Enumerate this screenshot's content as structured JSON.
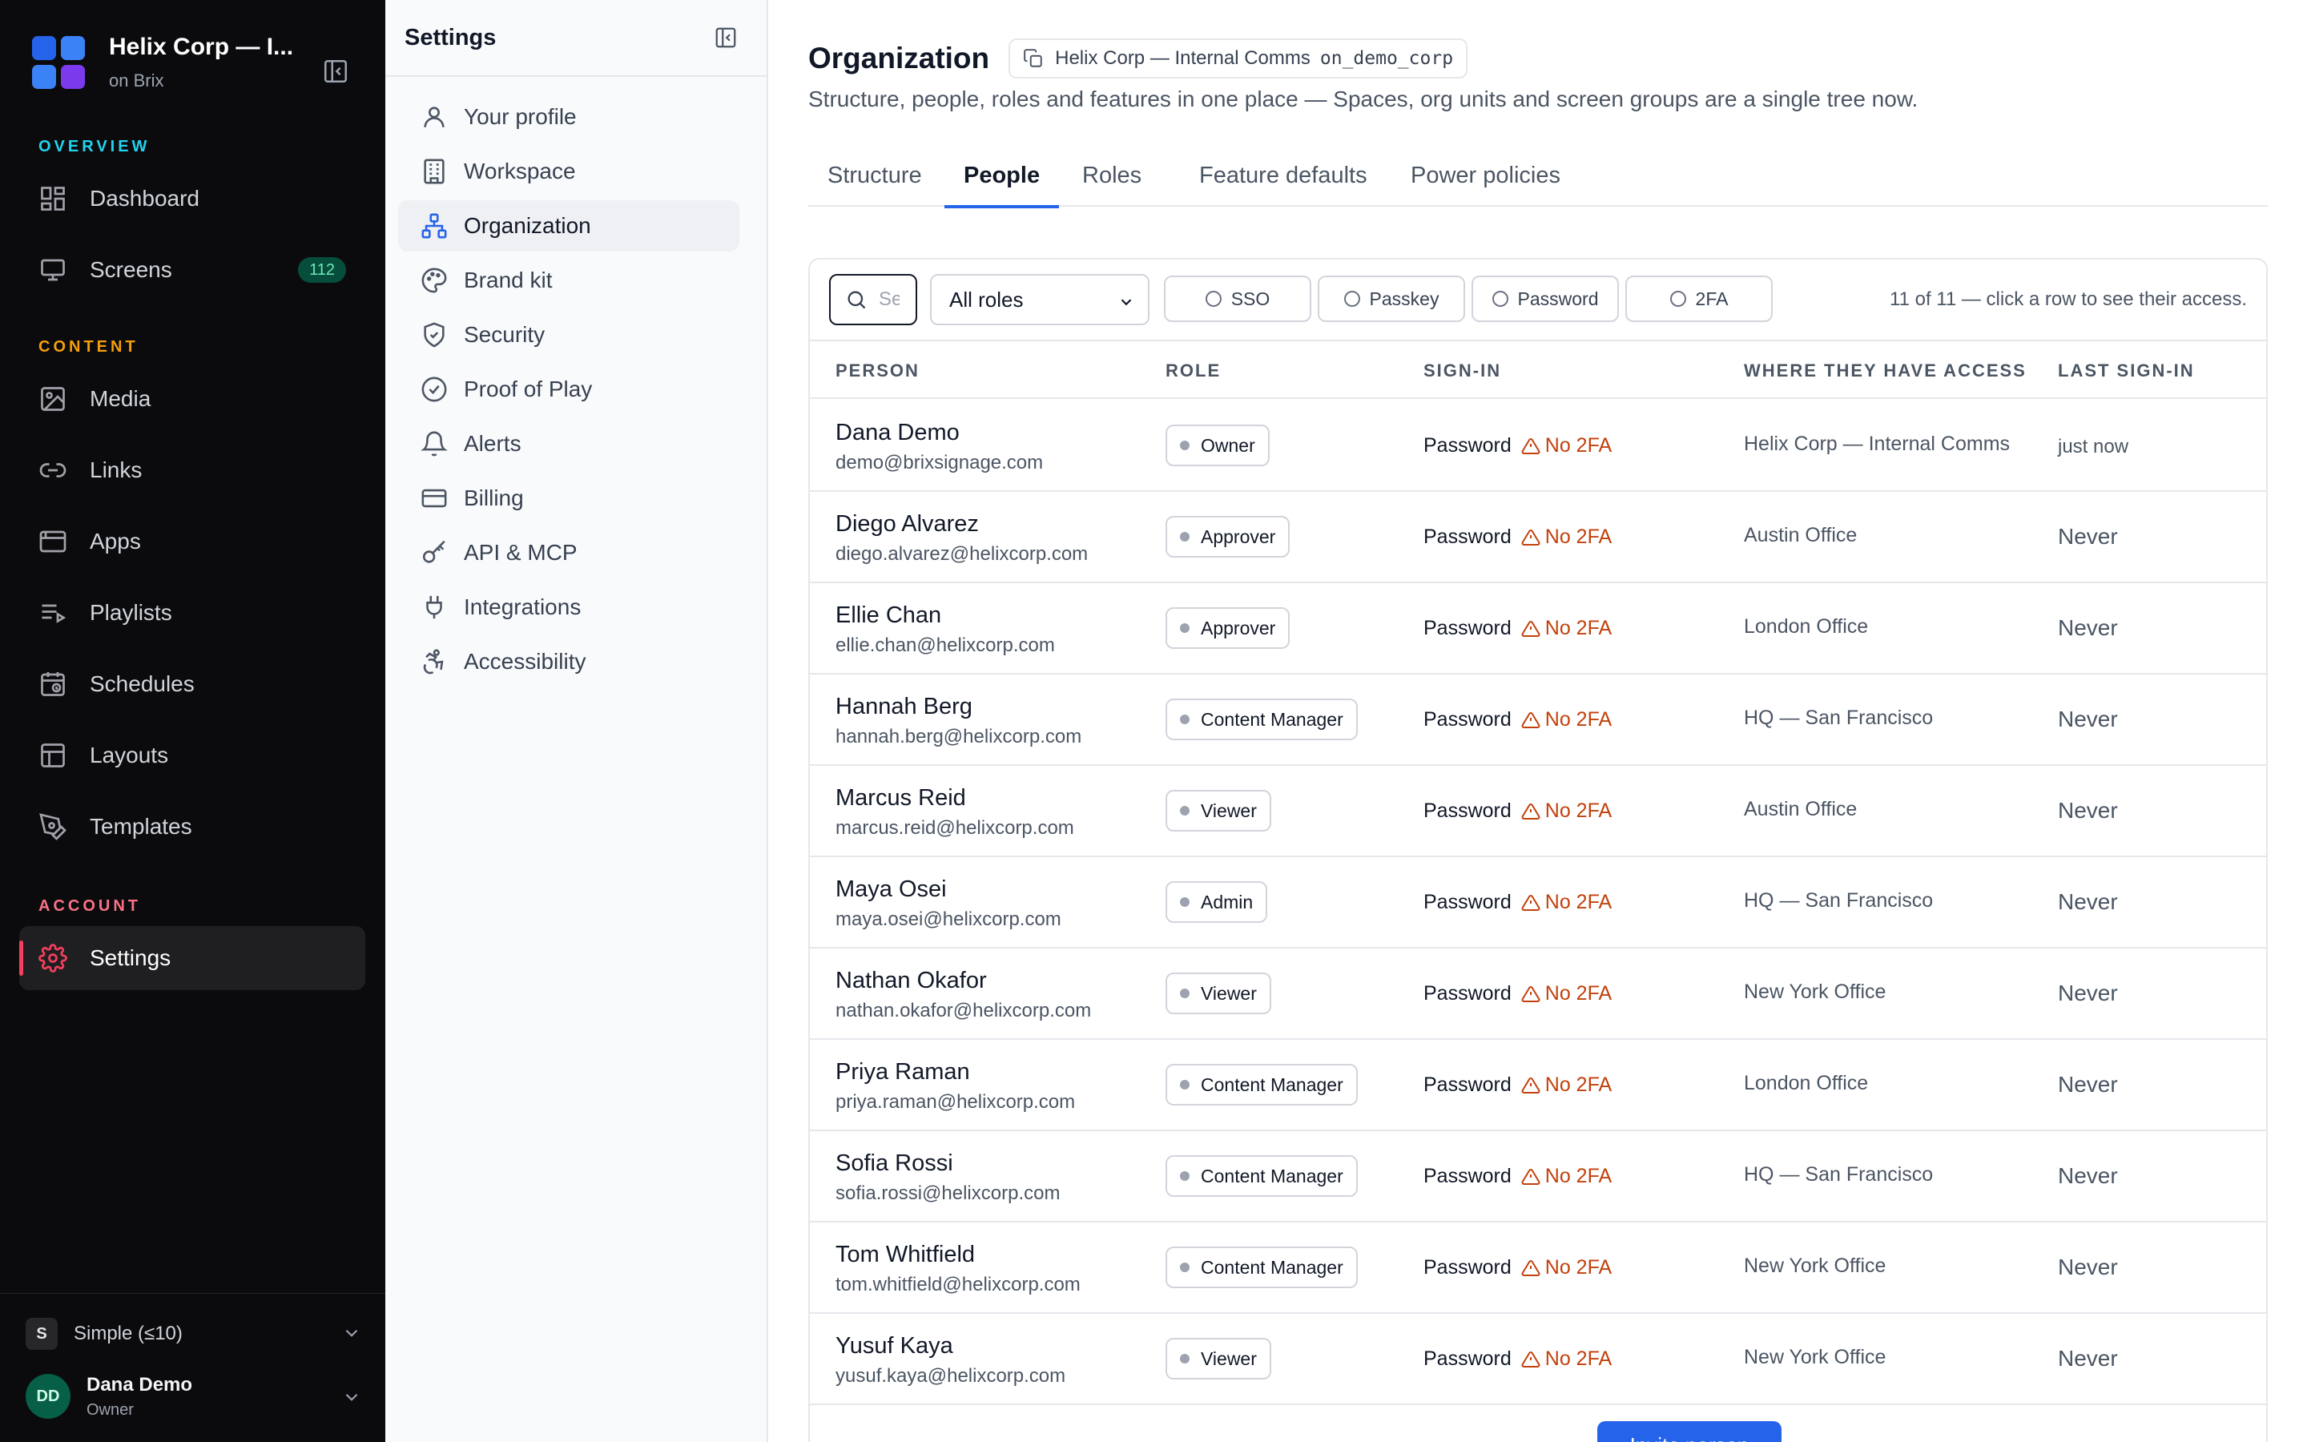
{
  "app": {
    "brand_title": "Helix Corp — I...",
    "brand_sub": "on Brix",
    "sections": {
      "overview": "OVERVIEW",
      "content": "CONTENT",
      "account": "ACCOUNT"
    },
    "nav": {
      "dashboard": "Dashboard",
      "screens": "Screens",
      "screens_count": "112",
      "media": "Media",
      "links": "Links",
      "apps": "Apps",
      "playlists": "Playlists",
      "schedules": "Schedules",
      "layouts": "Layouts",
      "templates": "Templates",
      "settings": "Settings"
    },
    "mode": {
      "chip": "S",
      "label": "Simple (≤10)"
    },
    "user": {
      "initials": "DD",
      "name": "Dana Demo",
      "role": "Owner"
    },
    "colors": {
      "accent": "#2563eb",
      "active_nav": "#f43f5e",
      "overview": "#22d3ee",
      "content": "#f59e0b",
      "account": "#fb7185",
      "warning": "#c2410c"
    }
  },
  "settings_nav": {
    "title": "Settings",
    "items": [
      {
        "label": "Your profile",
        "icon": "user-icon"
      },
      {
        "label": "Workspace",
        "icon": "building-icon"
      },
      {
        "label": "Organization",
        "icon": "org-chart-icon",
        "active": true
      },
      {
        "label": "Brand kit",
        "icon": "palette-icon"
      },
      {
        "label": "Security",
        "icon": "shield-icon"
      },
      {
        "label": "Proof of Play",
        "icon": "check-circle-icon"
      },
      {
        "label": "Alerts",
        "icon": "bell-icon"
      },
      {
        "label": "Billing",
        "icon": "credit-card-icon"
      },
      {
        "label": "API & MCP",
        "icon": "key-icon"
      },
      {
        "label": "Integrations",
        "icon": "plug-icon"
      },
      {
        "label": "Accessibility",
        "icon": "accessibility-icon"
      }
    ]
  },
  "page": {
    "title": "Organization",
    "org_name": "Helix Corp — Internal Comms",
    "org_code": "on_demo_corp",
    "subtitle": "Structure, people, roles and features in one place — Spaces, org units and screen groups are a single tree now.",
    "tabs": [
      "Structure",
      "People",
      "Roles",
      "Feature defaults",
      "Power policies"
    ],
    "active_tab": "People"
  },
  "people": {
    "search_placeholder": "Search",
    "role_filter": "All roles",
    "filters": [
      "SSO",
      "Passkey",
      "Password",
      "2FA"
    ],
    "count_text": "11 of 11 — click a row to see their access.",
    "columns": [
      "PERSON",
      "ROLE",
      "SIGN-IN",
      "WHERE THEY HAVE ACCESS",
      "LAST SIGN-IN"
    ],
    "rows": [
      {
        "name": "Dana Demo",
        "email": "demo@brixsignage.com",
        "role": "Owner",
        "signin": "Password",
        "warning": "No 2FA",
        "access": "Helix Corp — Internal Comms",
        "last": "just now"
      },
      {
        "name": "Diego Alvarez",
        "email": "diego.alvarez@helixcorp.com",
        "role": "Approver",
        "signin": "Password",
        "warning": "No 2FA",
        "access": "Austin Office",
        "last": "Never"
      },
      {
        "name": "Ellie Chan",
        "email": "ellie.chan@helixcorp.com",
        "role": "Approver",
        "signin": "Password",
        "warning": "No 2FA",
        "access": "London Office",
        "last": "Never"
      },
      {
        "name": "Hannah Berg",
        "email": "hannah.berg@helixcorp.com",
        "role": "Content Manager",
        "signin": "Password",
        "warning": "No 2FA",
        "access": "HQ — San Francisco",
        "last": "Never"
      },
      {
        "name": "Marcus Reid",
        "email": "marcus.reid@helixcorp.com",
        "role": "Viewer",
        "signin": "Password",
        "warning": "No 2FA",
        "access": "Austin Office",
        "last": "Never"
      },
      {
        "name": "Maya Osei",
        "email": "maya.osei@helixcorp.com",
        "role": "Admin",
        "signin": "Password",
        "warning": "No 2FA",
        "access": "HQ — San Francisco",
        "last": "Never"
      },
      {
        "name": "Nathan Okafor",
        "email": "nathan.okafor@helixcorp.com",
        "role": "Viewer",
        "signin": "Password",
        "warning": "No 2FA",
        "access": "New York Office",
        "last": "Never"
      },
      {
        "name": "Priya Raman",
        "email": "priya.raman@helixcorp.com",
        "role": "Content Manager",
        "signin": "Password",
        "warning": "No 2FA",
        "access": "London Office",
        "last": "Never"
      },
      {
        "name": "Sofia Rossi",
        "email": "sofia.rossi@helixcorp.com",
        "role": "Content Manager",
        "signin": "Password",
        "warning": "No 2FA",
        "access": "HQ — San Francisco",
        "last": "Never"
      },
      {
        "name": "Tom Whitfield",
        "email": "tom.whitfield@helixcorp.com",
        "role": "Content Manager",
        "signin": "Password",
        "warning": "No 2FA",
        "access": "New York Office",
        "last": "Never"
      },
      {
        "name": "Yusuf Kaya",
        "email": "yusuf.kaya@helixcorp.com",
        "role": "Viewer",
        "signin": "Password",
        "warning": "No 2FA",
        "access": "New York Office",
        "last": "Never"
      }
    ],
    "primary_action": "Invite person"
  }
}
